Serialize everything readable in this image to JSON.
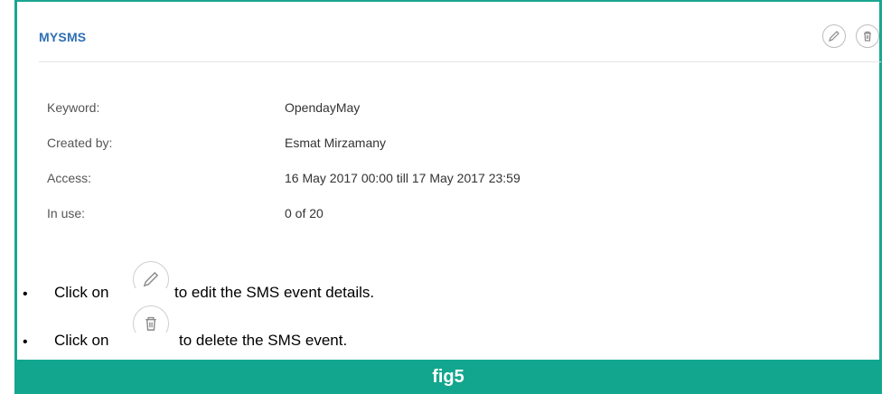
{
  "card": {
    "title": "MYSMS",
    "actions": {
      "edit_icon": "pencil-icon",
      "delete_icon": "trash-icon"
    },
    "details": [
      {
        "label": "Keyword:",
        "value": "OpendayMay"
      },
      {
        "label": "Created by:",
        "value": "Esmat Mirzamany"
      },
      {
        "label": "Access:",
        "value": "16 May 2017 00:00 till 17 May 2017 23:59"
      },
      {
        "label": "In use:",
        "value": "0 of 20"
      }
    ]
  },
  "instructions": [
    {
      "prefix": "Click on",
      "icon": "pencil-icon",
      "suffix": "to edit the SMS event details."
    },
    {
      "prefix": "Click on",
      "icon": "trash-icon",
      "suffix": "to delete the SMS event."
    }
  ],
  "figure": {
    "caption": "fig5"
  },
  "colors": {
    "accent": "#13a68e",
    "title": "#2f6fb3"
  }
}
